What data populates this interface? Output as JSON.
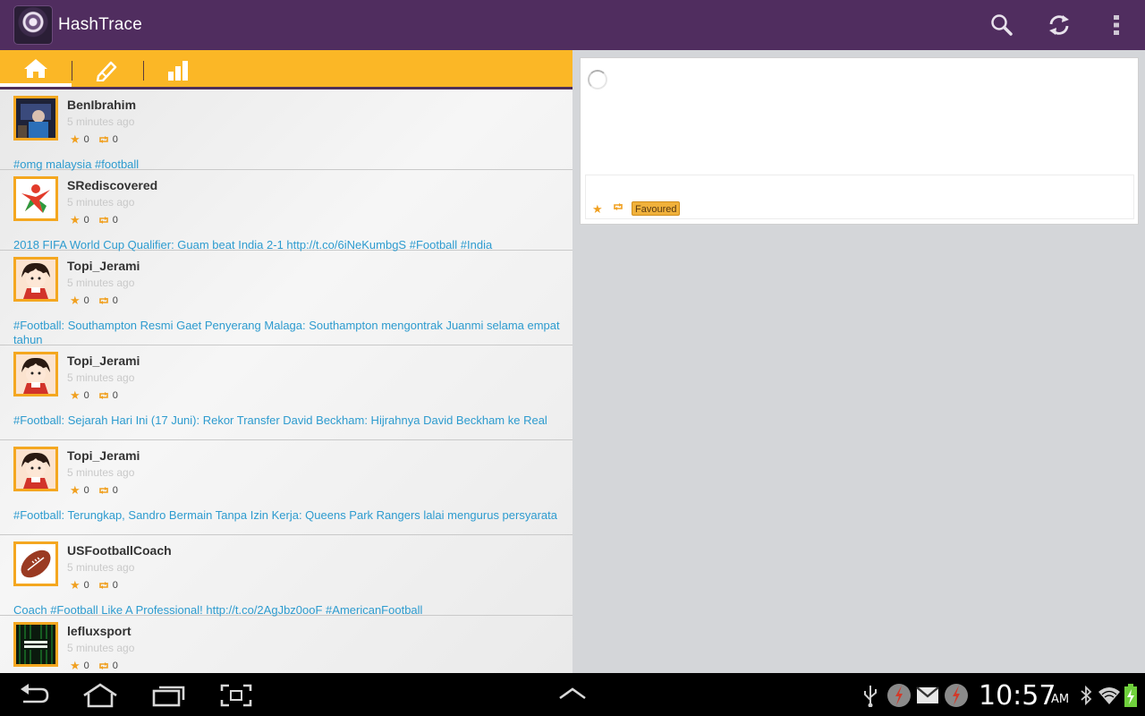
{
  "app": {
    "title": "HashTrace",
    "accent": "#fbb726",
    "bar_color": "#502d5f",
    "link_color": "#2d9bcf"
  },
  "actionbar": {
    "icons": [
      "search-icon",
      "refresh-icon",
      "overflow-menu-icon"
    ]
  },
  "tabs": [
    {
      "icon": "home-icon",
      "selected": true
    },
    {
      "icon": "compose-icon",
      "selected": false
    },
    {
      "icon": "stats-icon",
      "selected": false
    }
  ],
  "tweets": [
    {
      "username": "BenIbrahim",
      "time": "5 minutes ago",
      "favorites": "0",
      "retweets": "0",
      "text": "#omg malaysia #football"
    },
    {
      "username": "SRediscovered",
      "time": "5 minutes ago",
      "favorites": "0",
      "retweets": "0",
      "text": "2018 FIFA World Cup Qualifier: Guam beat India 2-1 http://t.co/6iNeKumbgS #Football #India"
    },
    {
      "username": "Topi_Jerami",
      "time": "5 minutes ago",
      "favorites": "0",
      "retweets": "0",
      "text": "#Football: Southampton Resmi Gaet Penyerang Malaga: Southampton mengontrak Juanmi selama empat tahun"
    },
    {
      "username": "Topi_Jerami",
      "time": "5 minutes ago",
      "favorites": "0",
      "retweets": "0",
      "text": "#Football: Sejarah Hari Ini (17 Juni): Rekor Transfer David Beckham: Hijrahnya David Beckham ke Real"
    },
    {
      "username": "Topi_Jerami",
      "time": "5 minutes ago",
      "favorites": "0",
      "retweets": "0",
      "text": "#Football: Terungkap, Sandro Bermain Tanpa Izin Kerja: Queens Park Rangers lalai mengurus persyarata"
    },
    {
      "username": "USFootballCoach",
      "time": "5 minutes ago",
      "favorites": "0",
      "retweets": "0",
      "text": "Coach #Football Like A Professional! http://t.co/2AgJbz0ooF #AmericanFootball"
    },
    {
      "username": "lefluxsport",
      "time": "5 minutes ago",
      "favorites": "0",
      "retweets": "0",
      "text": ""
    }
  ],
  "detail": {
    "favourite_label": "Favoured"
  },
  "status": {
    "time": "10:57",
    "ampm": "AM"
  }
}
